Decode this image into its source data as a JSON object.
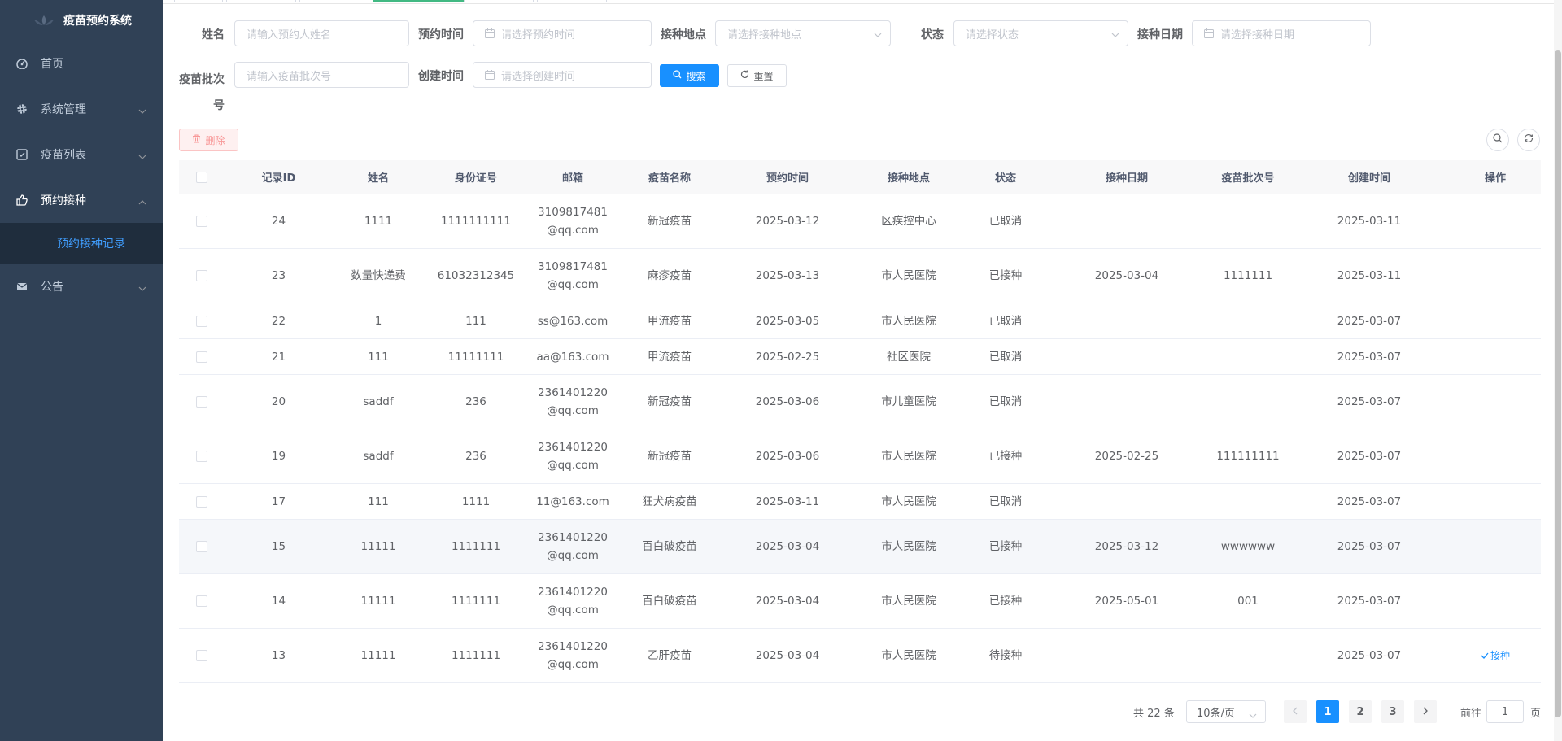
{
  "app": {
    "title": "疫苗预约系统"
  },
  "sidebar": {
    "items": [
      {
        "label": "首页",
        "icon": "dashboard-icon"
      },
      {
        "label": "系统管理",
        "icon": "gear-icon"
      },
      {
        "label": "疫苗列表",
        "icon": "checklist-icon"
      },
      {
        "label": "预约接种",
        "icon": "thumb-icon"
      },
      {
        "label": "公告",
        "icon": "mail-icon"
      }
    ],
    "sub": {
      "label": "预约接种记录"
    }
  },
  "search": {
    "name_label": "姓名",
    "name_placeholder": "请输入预约人姓名",
    "appt_label": "预约时间",
    "appt_placeholder": "请选择预约时间",
    "site_label": "接种地点",
    "site_placeholder": "请选择接种地点",
    "status_label": "状态",
    "status_placeholder": "请选择状态",
    "date_label": "接种日期",
    "date_placeholder": "请选择接种日期",
    "batch_label_1": "疫苗批次",
    "batch_label_2": "号",
    "batch_placeholder": "请输入疫苗批次号",
    "created_label": "创建时间",
    "created_placeholder": "请选择创建时间",
    "search_btn": "搜索",
    "reset_btn": "重置"
  },
  "toolbar": {
    "delete_btn": "删除"
  },
  "table": {
    "headers": [
      "记录ID",
      "姓名",
      "身份证号",
      "邮箱",
      "疫苗名称",
      "预约时间",
      "接种地点",
      "状态",
      "接种日期",
      "疫苗批次号",
      "创建时间",
      "操作"
    ],
    "rows": [
      {
        "id": "24",
        "name": "1111",
        "idcard": "1111111111",
        "email": "3109817481@qq.com",
        "vaccine": "新冠疫苗",
        "appt": "2025-03-12",
        "site": "区疾控中心",
        "status": "已取消",
        "date": "",
        "batch": "",
        "created": "2025-03-11",
        "action": ""
      },
      {
        "id": "23",
        "name": "数量快递费",
        "idcard": "61032312345",
        "email": "3109817481@qq.com",
        "vaccine": "麻疹疫苗",
        "appt": "2025-03-13",
        "site": "市人民医院",
        "status": "已接种",
        "date": "2025-03-04",
        "batch": "1111111",
        "created": "2025-03-11",
        "action": ""
      },
      {
        "id": "22",
        "name": "1",
        "idcard": "111",
        "email": "ss@163.com",
        "vaccine": "甲流疫苗",
        "appt": "2025-03-05",
        "site": "市人民医院",
        "status": "已取消",
        "date": "",
        "batch": "",
        "created": "2025-03-07",
        "action": ""
      },
      {
        "id": "21",
        "name": "111",
        "idcard": "11111111",
        "email": "aa@163.com",
        "vaccine": "甲流疫苗",
        "appt": "2025-02-25",
        "site": "社区医院",
        "status": "已取消",
        "date": "",
        "batch": "",
        "created": "2025-03-07",
        "action": ""
      },
      {
        "id": "20",
        "name": "saddf",
        "idcard": "236",
        "email": "2361401220@qq.com",
        "vaccine": "新冠疫苗",
        "appt": "2025-03-06",
        "site": "市儿童医院",
        "status": "已取消",
        "date": "",
        "batch": "",
        "created": "2025-03-07",
        "action": ""
      },
      {
        "id": "19",
        "name": "saddf",
        "idcard": "236",
        "email": "2361401220@qq.com",
        "vaccine": "新冠疫苗",
        "appt": "2025-03-06",
        "site": "市人民医院",
        "status": "已接种",
        "date": "2025-02-25",
        "batch": "111111111",
        "created": "2025-03-07",
        "action": ""
      },
      {
        "id": "17",
        "name": "111",
        "idcard": "1111",
        "email": "11@163.com",
        "vaccine": "狂犬病疫苗",
        "appt": "2025-03-11",
        "site": "市人民医院",
        "status": "已取消",
        "date": "",
        "batch": "",
        "created": "2025-03-07",
        "action": ""
      },
      {
        "id": "15",
        "name": "11111",
        "idcard": "1111111",
        "email": "2361401220@qq.com",
        "vaccine": "百白破疫苗",
        "appt": "2025-03-04",
        "site": "市人民医院",
        "status": "已接种",
        "date": "2025-03-12",
        "batch": "wwwwww",
        "created": "2025-03-07",
        "action": ""
      },
      {
        "id": "14",
        "name": "11111",
        "idcard": "1111111",
        "email": "2361401220@qq.com",
        "vaccine": "百白破疫苗",
        "appt": "2025-03-04",
        "site": "市人民医院",
        "status": "已接种",
        "date": "2025-05-01",
        "batch": "001",
        "created": "2025-03-07",
        "action": ""
      },
      {
        "id": "13",
        "name": "11111",
        "idcard": "1111111",
        "email": "2361401220@qq.com",
        "vaccine": "乙肝疫苗",
        "appt": "2025-03-04",
        "site": "市人民医院",
        "status": "待接种",
        "date": "",
        "batch": "",
        "created": "2025-03-07",
        "action": "接种"
      }
    ]
  },
  "pagination": {
    "total": "共 22 条",
    "page_size": "10条/页",
    "pages": [
      "1",
      "2",
      "3"
    ],
    "current": "1",
    "goto_label": "前往",
    "goto_value": "1",
    "page_suffix": "页"
  }
}
